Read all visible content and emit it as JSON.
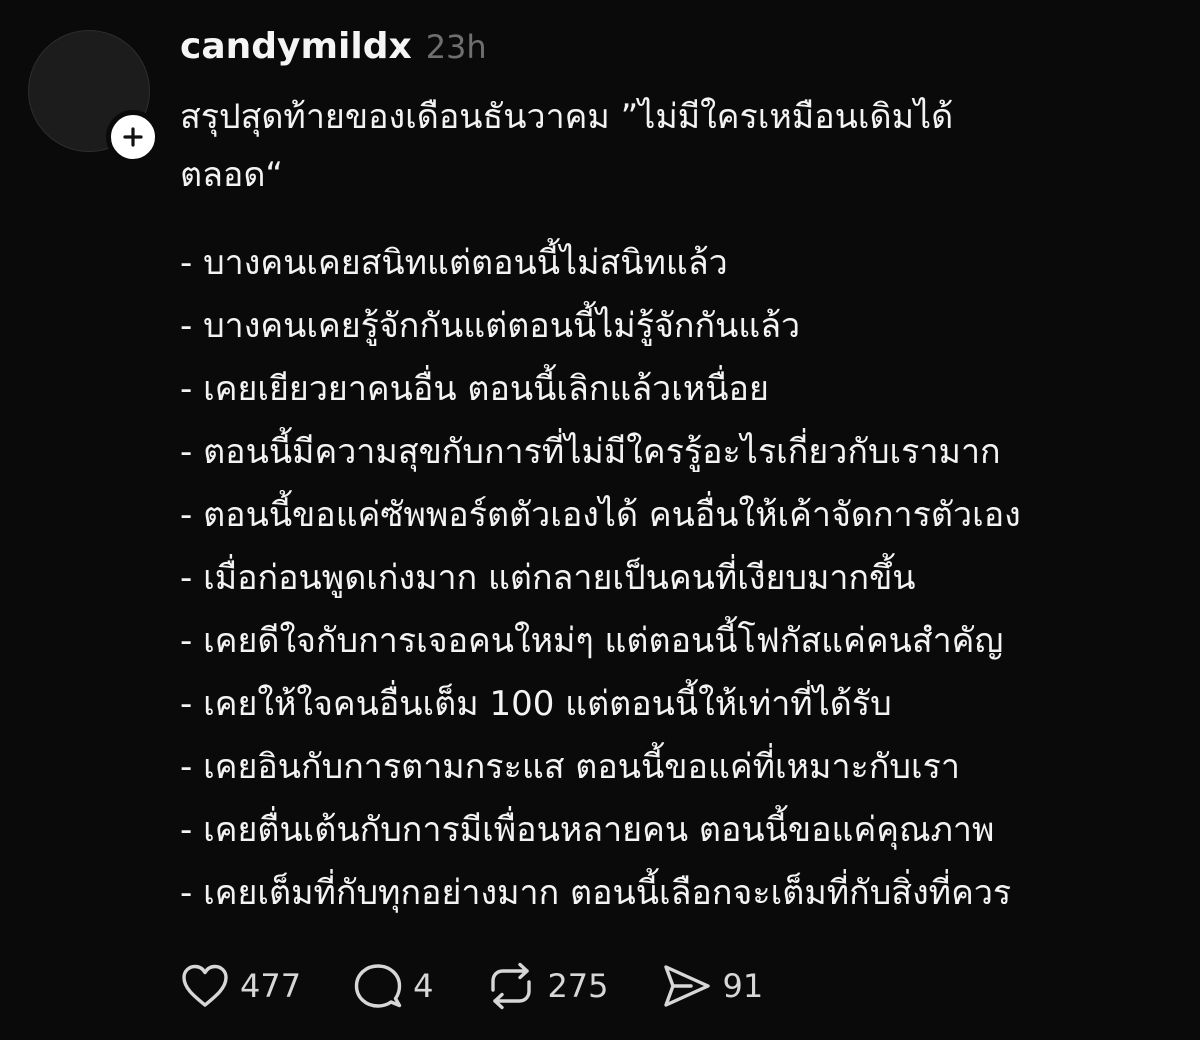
{
  "post": {
    "username": "candymildx",
    "time": "23h",
    "intro": [
      "สรุปสุดท้ายของเดือนธันวาคม ”ไม่มีใครเหมือนเดิมได้",
      "ตลอด“"
    ],
    "list": [
      "- บางคนเคยสนิทแต่ตอนนี้ไม่สนิทแล้ว",
      "- บางคนเคยรู้จักกันแต่ตอนนี้ไม่รู้จักกันแล้ว",
      "- เคยเยียวยาคนอื่น ตอนนี้เลิกแล้วเหนื่อย",
      "- ตอนนี้มีความสุขกับการที่ไม่มีใครรู้อะไรเกี่ยวกับเรามาก",
      "- ตอนนี้ขอแค่ซัพพอร์ตตัวเองได้ คนอื่นให้เค้าจัดการตัวเอง",
      "- เมื่อก่อนพูดเก่งมาก แต่กลายเป็นคนที่เงียบมากขึ้น",
      "- เคยดีใจกับการเจอคนใหม่ๆ แต่ตอนนี้โฟกัสแค่คนสำคัญ",
      "- เคยให้ใจคนอื่นเต็ม 100 แต่ตอนนี้ให้เท่าที่ได้รับ",
      "- เคยอินกับการตามกระแส ตอนนี้ขอแค่ที่เหมาะกับเรา",
      "- เคยตื่นเต้นกับการมีเพื่อนหลายคน ตอนนี้ขอแค่คุณภาพ",
      "- เคยเต็มที่กับทุกอย่างมาก ตอนนี้เลือกจะเต็มที่กับสิ่งที่ควร"
    ]
  },
  "actions": {
    "likes": "477",
    "replies": "4",
    "reposts": "275",
    "shares": "91"
  },
  "icons": {
    "follow": "plus-icon",
    "like": "heart-icon",
    "reply": "speech-bubble-icon",
    "repost": "repost-arrows-icon",
    "share": "paper-plane-icon"
  },
  "colors": {
    "background": "#0a0a0a",
    "text": "#f3f3f3",
    "muted": "#6f6f6f",
    "icon": "#d7d7d7"
  }
}
